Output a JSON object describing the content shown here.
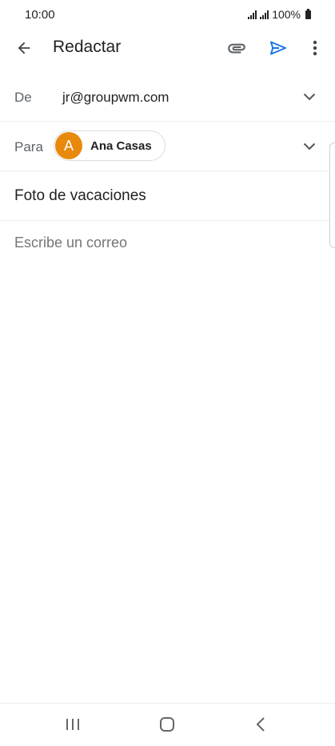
{
  "status_bar": {
    "time": "10:00",
    "battery_text": "100%",
    "signal_icon": "signal-bars-icon",
    "battery_icon": "battery-icon"
  },
  "app_bar": {
    "back_icon": "arrow-back-icon",
    "title": "Redactar",
    "attach_icon": "paperclip-icon",
    "send_icon": "send-icon",
    "more_icon": "more-vert-icon"
  },
  "compose": {
    "from": {
      "label": "De",
      "value": "jr@groupwm.com",
      "expand_icon": "chevron-down-icon"
    },
    "to": {
      "label": "Para",
      "recipients": [
        {
          "initial": "A",
          "name": "Ana Casas",
          "avatar_color": "#e8890c"
        }
      ],
      "expand_icon": "chevron-down-icon"
    },
    "subject": "Foto de vacaciones",
    "body_placeholder": "Escribe un correo"
  },
  "colors": {
    "accent": "#1a73e8",
    "avatar": "#e8890c",
    "text_primary": "#202124",
    "text_secondary": "#5f6368"
  },
  "nav_bar": {
    "recents_icon": "recent-apps-icon",
    "home_icon": "home-icon",
    "back_icon": "nav-back-icon"
  }
}
